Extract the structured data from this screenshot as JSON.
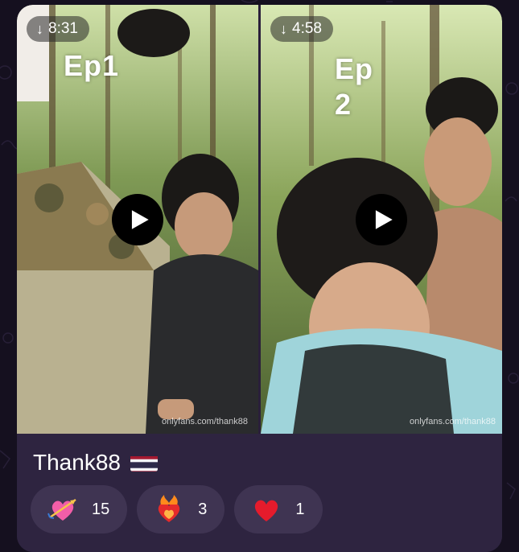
{
  "videos": [
    {
      "duration": "8:31",
      "overlay_title": "Ep1",
      "watermark": "onlyfans.com/thank88"
    },
    {
      "duration": "4:58",
      "overlay_title": "Ep\n2",
      "watermark": "onlyfans.com/thank88"
    }
  ],
  "post": {
    "title": "Thank88",
    "flag_icon": "thailand-flag-icon"
  },
  "reactions": [
    {
      "icon": "heart-with-arrow-icon",
      "count": "15"
    },
    {
      "icon": "heart-on-fire-icon",
      "count": "3"
    },
    {
      "icon": "red-heart-icon",
      "count": "1"
    }
  ],
  "colors": {
    "background": "#15101f",
    "card": "#2e2440",
    "reaction_pill": "#3f3452"
  }
}
